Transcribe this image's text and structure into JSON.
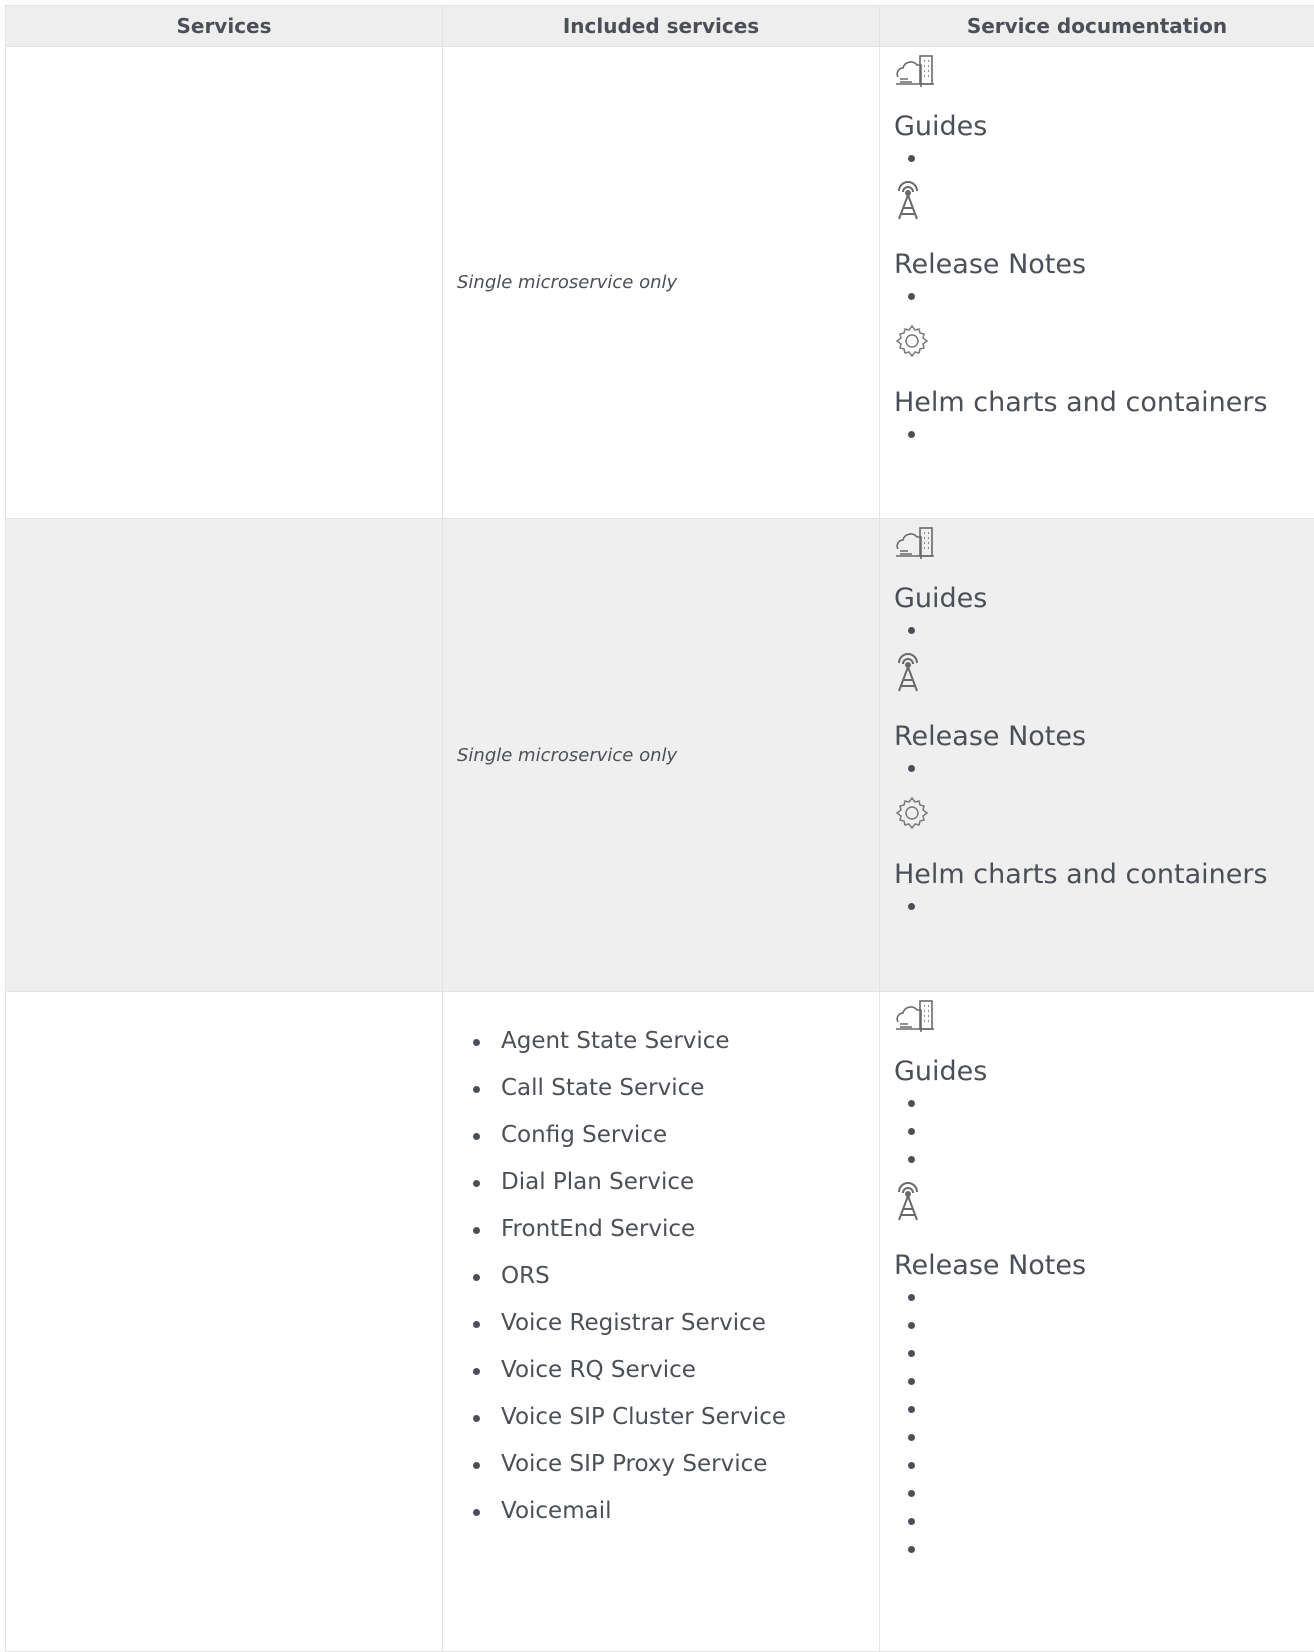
{
  "table": {
    "headers": [
      "Services",
      "Included services",
      "Service documentation"
    ],
    "rows": [
      {
        "service": "",
        "included_text": "Single microservice only",
        "included_list": [],
        "docs": [
          {
            "icon": "cloud-building-icon",
            "title": "Guides",
            "bullet_count": 1
          },
          {
            "icon": "broadcast-tower-icon",
            "title": "Release Notes",
            "bullet_count": 1
          },
          {
            "icon": "gear-icon",
            "title": "Helm charts and containers",
            "bullet_count": 1
          }
        ]
      },
      {
        "service": "",
        "included_text": "Single microservice only",
        "included_list": [],
        "docs": [
          {
            "icon": "cloud-building-icon",
            "title": "Guides",
            "bullet_count": 1
          },
          {
            "icon": "broadcast-tower-icon",
            "title": "Release Notes",
            "bullet_count": 1
          },
          {
            "icon": "gear-icon",
            "title": "Helm charts and containers",
            "bullet_count": 1
          }
        ]
      },
      {
        "service": "",
        "included_text": "",
        "included_list": [
          "Agent State Service",
          "Call State Service",
          "Config Service",
          "Dial Plan Service",
          "FrontEnd Service",
          "ORS",
          "Voice Registrar Service",
          "Voice RQ Service",
          "Voice SIP Cluster Service",
          "Voice SIP Proxy Service",
          "Voicemail"
        ],
        "docs": [
          {
            "icon": "cloud-building-icon",
            "title": "Guides",
            "bullet_count": 3
          },
          {
            "icon": "broadcast-tower-icon",
            "title": "Release Notes",
            "bullet_count": 10
          }
        ]
      }
    ]
  }
}
